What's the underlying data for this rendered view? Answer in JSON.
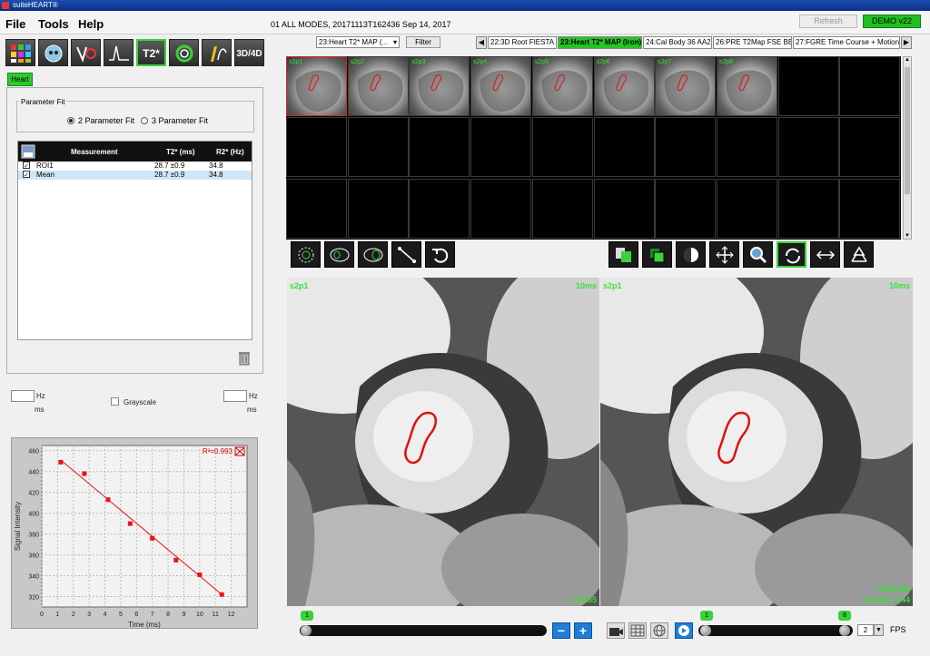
{
  "window": {
    "title": "suiteHEART®"
  },
  "menu": {
    "file": "File",
    "tools": "Tools",
    "help": "Help"
  },
  "header": {
    "series_info": "01 ALL MODES, 20171113T162436   Sep 14, 2017",
    "refresh_label": "Refresh",
    "demo_label": "DEMO v22"
  },
  "toolbar": {
    "t2_label": "T2*",
    "d3_label": "3D/4D"
  },
  "left": {
    "tab_label": "Heart",
    "param_fit": {
      "legend": "Parameter Fit",
      "opt2": "2 Parameter Fit",
      "opt3": "3 Parameter Fit",
      "selected": "2"
    },
    "table": {
      "headers": [
        "Measurement",
        "T2* (ms)",
        "R2* (Hz)"
      ],
      "rows": [
        {
          "name": "ROI1",
          "t2": "28.7 ±0.9",
          "r2": "34.8",
          "checked": true
        },
        {
          "name": "Mean",
          "t2": "28.7 ±0.9",
          "r2": "34.8",
          "checked": true
        }
      ]
    },
    "units": {
      "hz": "Hz",
      "ms": "ms"
    },
    "grayscale_label": "Grayscale"
  },
  "chart_data": {
    "type": "scatter",
    "xlabel": "Time (ms)",
    "ylabel": "Signal Intensity",
    "annotation": "R²=0.993",
    "xlim": [
      0,
      13
    ],
    "ylim": [
      310,
      465
    ],
    "xticks": [
      "0",
      "1",
      "2",
      "3",
      "4",
      "5",
      "6",
      "7",
      "8",
      "9",
      "10",
      "11",
      "12"
    ],
    "yticks": [
      "320",
      "340",
      "360",
      "380",
      "400",
      "420",
      "440",
      "460"
    ],
    "points": [
      {
        "x": 1.2,
        "y": 449
      },
      {
        "x": 2.7,
        "y": 438
      },
      {
        "x": 4.2,
        "y": 413
      },
      {
        "x": 5.6,
        "y": 390
      },
      {
        "x": 7.0,
        "y": 376
      },
      {
        "x": 8.5,
        "y": 355
      },
      {
        "x": 10.0,
        "y": 341
      },
      {
        "x": 11.4,
        "y": 322
      }
    ],
    "fit_line": [
      {
        "x": 1.2,
        "y": 451
      },
      {
        "x": 11.4,
        "y": 322
      }
    ],
    "colors": {
      "marker": "#ee1111",
      "line": "#ee1111",
      "plot_bg": "#f2f2f2"
    }
  },
  "series_bar": {
    "select_label": "23:Heart T2* MAP (...",
    "filter_label": "Filter",
    "tabs": [
      {
        "label": "22:3D Root FIESTA",
        "active": false
      },
      {
        "label": "23:Heart T2* MAP (Iron)",
        "active": true
      },
      {
        "label": "24:Cal Body 36 AA2",
        "active": false
      },
      {
        "label": "26:PRE T2Map FSE BB",
        "active": false
      },
      {
        "label": "27:FGRE Time Course + Motion",
        "active": false
      }
    ]
  },
  "thumbnails": [
    {
      "label": "s2p1"
    },
    {
      "label": "s2p2"
    },
    {
      "label": "s2p3"
    },
    {
      "label": "s2p4"
    },
    {
      "label": "s2p5"
    },
    {
      "label": "s2p6"
    },
    {
      "label": "s2p7"
    },
    {
      "label": "s2p8"
    }
  ],
  "viewers": {
    "left": {
      "series_label": "s2p1",
      "time_label": "10ms",
      "level_label": "L 46:55"
    },
    "right": {
      "series_label": "s2p1",
      "time_label": "10ms",
      "matrix_label": "256x256",
      "wl_label": "W:249 L:244"
    }
  },
  "bottom": {
    "slice_flag": "1",
    "phase_start_flag": "1",
    "phase_end_flag": "8",
    "minus_label": "−",
    "plus_label": "+",
    "fps_value": "2",
    "fps_label": "FPS"
  },
  "colors": {
    "accent_green": "#22c622",
    "roi_red": "#e01010",
    "overlay_green": "#3ae03a"
  }
}
